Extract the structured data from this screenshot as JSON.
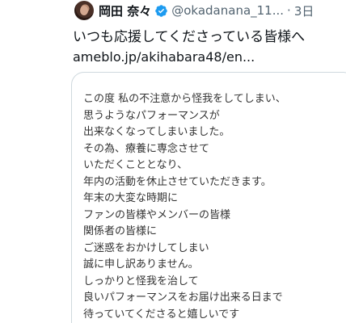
{
  "tweet": {
    "display_name": "岡田 奈々",
    "handle": "@okadanana_11...",
    "separator": "·",
    "time": "3日",
    "text": "いつも応援してくださっている皆様へ",
    "link": "ameblo.jp/akihabara48/en..."
  },
  "card": {
    "lines": [
      "この度 私の不注意から怪我をしてしまい、",
      "思うようなパフォーマンスが",
      "出来なくなってしまいました。",
      "その為、療養に専念させて",
      "いただくこととなり、",
      "年内の活動を休止させていただきます。",
      "年末の大変な時期に",
      "ファンの皆様やメンバーの皆様",
      "関係者の皆様に",
      "ご迷惑をおかけしてしまい",
      "誠に申し訳ありません。",
      "しっかりと怪我を治して",
      "良いパフォーマンスをお届け出来る日まで",
      "待っていてくださると嬉しいです"
    ]
  },
  "colors": {
    "verified": "#1d9bf0",
    "secondary_text": "#536471",
    "card_border": "#cfd9de"
  },
  "icons": {
    "verified": "verified-badge-icon",
    "avatar": "avatar"
  }
}
